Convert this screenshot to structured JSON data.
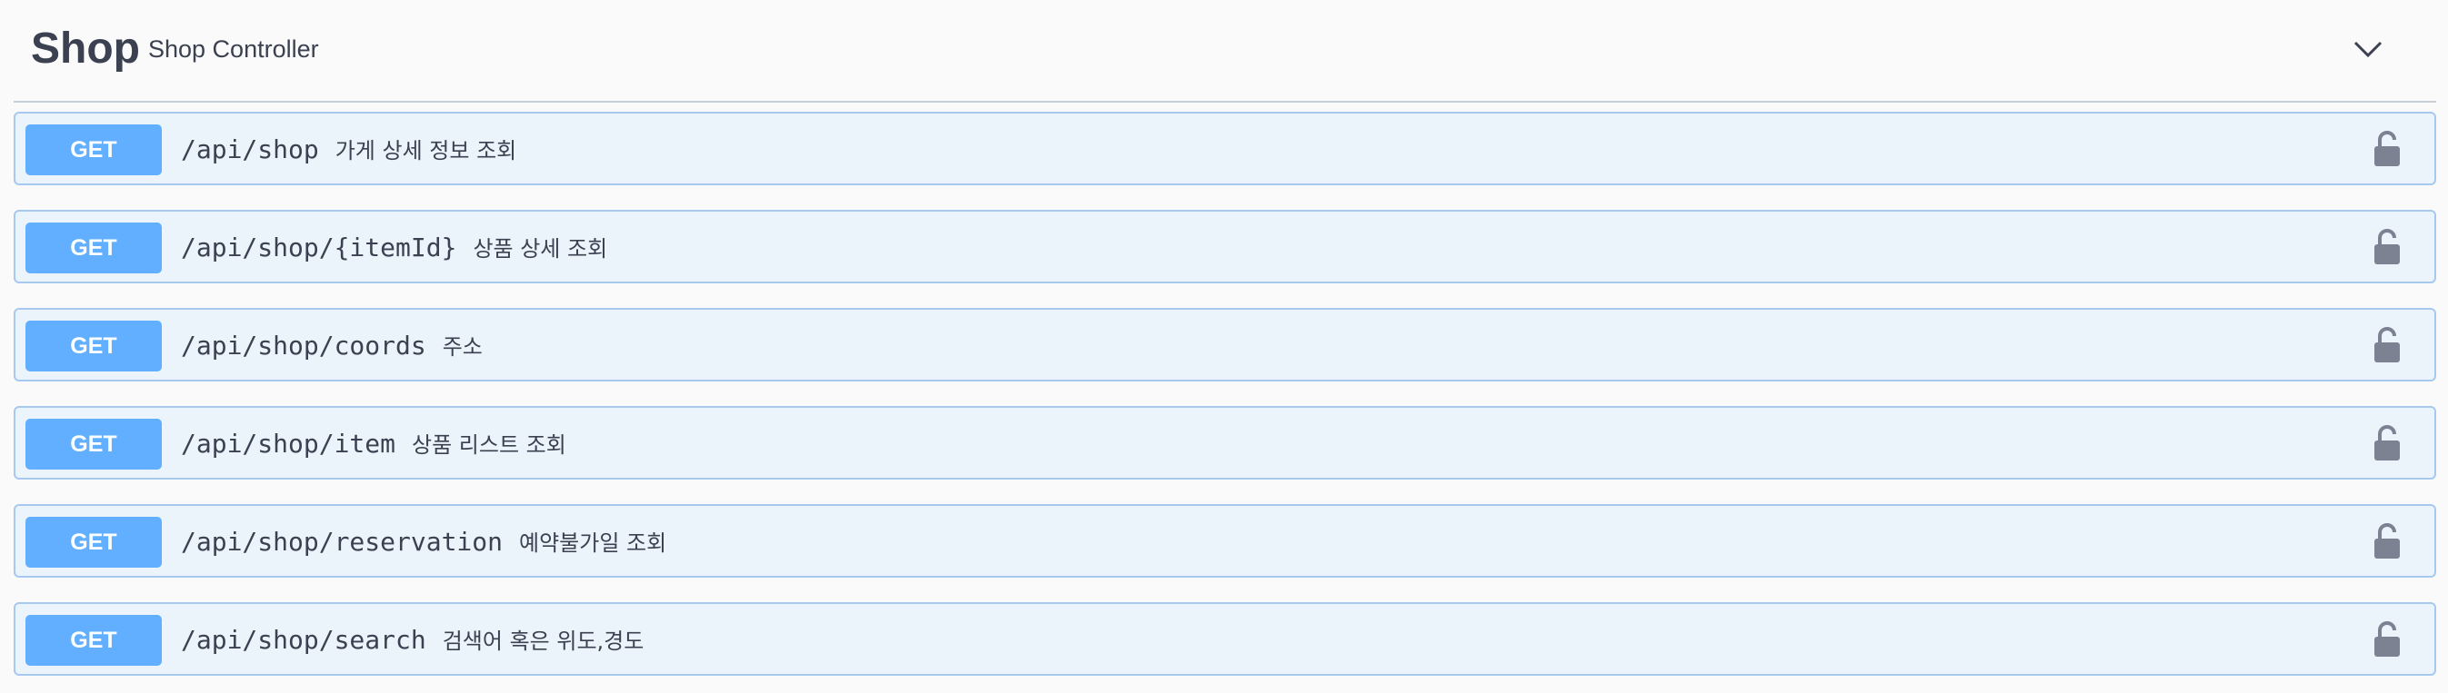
{
  "tag": {
    "name": "Shop",
    "description": "Shop Controller"
  },
  "operations": [
    {
      "method": "GET",
      "path": "/api/shop",
      "summary": "가게 상세 정보 조회"
    },
    {
      "method": "GET",
      "path": "/api/shop/{itemId}",
      "summary": "상품 상세 조회"
    },
    {
      "method": "GET",
      "path": "/api/shop/coords",
      "summary": "주소"
    },
    {
      "method": "GET",
      "path": "/api/shop/item",
      "summary": "상품 리스트 조회"
    },
    {
      "method": "GET",
      "path": "/api/shop/reservation",
      "summary": "예약불가일 조회"
    },
    {
      "method": "GET",
      "path": "/api/shop/search",
      "summary": "검색어 혹은 위도,경도"
    }
  ],
  "icons": {
    "chevron": "chevron-down-icon",
    "lock": "lock-icon"
  },
  "colors": {
    "get_method": "#61affe",
    "op_background": "#ebf3fb",
    "op_border": "#a7c8ef",
    "text": "#3b4151",
    "lock": "#7d8293"
  }
}
